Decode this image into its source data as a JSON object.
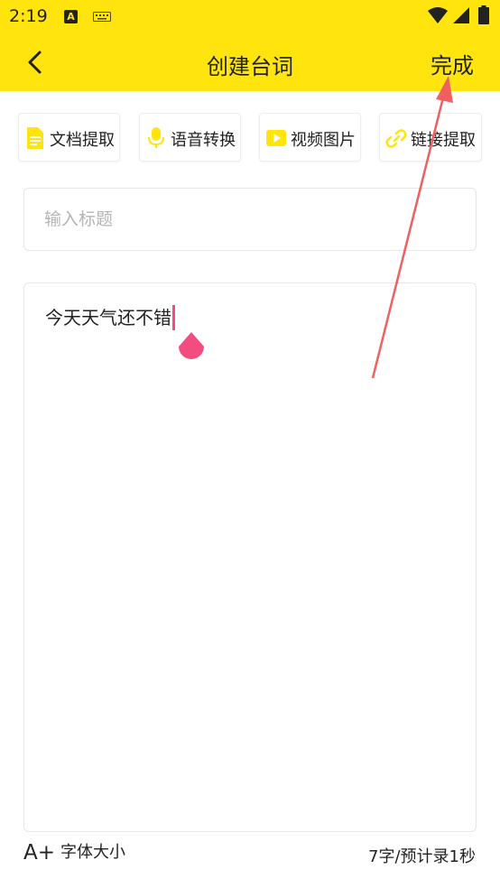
{
  "status_bar": {
    "time": "2:19",
    "icons": [
      "a-notification-icon",
      "keyboard-icon",
      "wifi-icon",
      "signal-icon",
      "battery-icon"
    ]
  },
  "header": {
    "title": "创建台词",
    "done_label": "完成",
    "back_icon": "chevron-left-icon",
    "background_color": "#FFE40E"
  },
  "tools": [
    {
      "label": "文档提取",
      "icon": "document-icon"
    },
    {
      "label": "语音转换",
      "icon": "microphone-icon"
    },
    {
      "label": "视频图片",
      "icon": "video-icon"
    },
    {
      "label": "链接提取",
      "icon": "link-icon"
    }
  ],
  "title_input": {
    "placeholder": "输入标题",
    "value": ""
  },
  "content": {
    "text": "今天天气还不错",
    "caret_color": "#F34C81"
  },
  "footer": {
    "font_size_icon": "A+",
    "font_size_label": "字体大小",
    "word_count": "7字/预计录1秒"
  },
  "annotation": {
    "arrow_color": "#F0605E"
  }
}
